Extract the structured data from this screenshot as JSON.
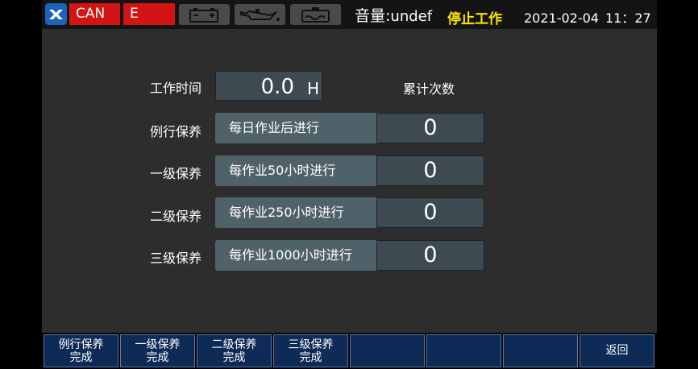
{
  "topbar": {
    "can_label": "CAN",
    "error_label": "E",
    "volume_label": "音量:",
    "volume_value": "undef",
    "status": "停止工作",
    "date": "2021-02-04",
    "time": "11：27",
    "colors": {
      "alarm_red": "#d31414",
      "status_yellow": "#ffe600",
      "logo_blue": "#1a63b8"
    },
    "icons": [
      "logo-icon",
      "battery-icon",
      "oil-pressure-icon",
      "coolant-icon"
    ]
  },
  "work_time": {
    "label": "工作时间",
    "value": "0.0",
    "unit": "H"
  },
  "count_header": "累计次数",
  "maintenance": [
    {
      "name": "例行保养",
      "schedule": "每日作业后进行",
      "count": "0"
    },
    {
      "name": "一级保养",
      "schedule": "每作业50小时进行",
      "count": "0"
    },
    {
      "name": "二级保养",
      "schedule": "每作业250小时进行",
      "count": "0"
    },
    {
      "name": "三级保养",
      "schedule": "每作业1000小时进行",
      "count": "0"
    }
  ],
  "function_keys": [
    {
      "line1": "例行保养",
      "line2": "完成"
    },
    {
      "line1": "一级保养",
      "line2": "完成"
    },
    {
      "line1": "二级保养",
      "line2": "完成"
    },
    {
      "line1": "三级保养",
      "line2": "完成"
    },
    {
      "line1": "",
      "line2": ""
    },
    {
      "line1": "",
      "line2": ""
    },
    {
      "line1": "",
      "line2": ""
    },
    {
      "single": "返回"
    }
  ]
}
